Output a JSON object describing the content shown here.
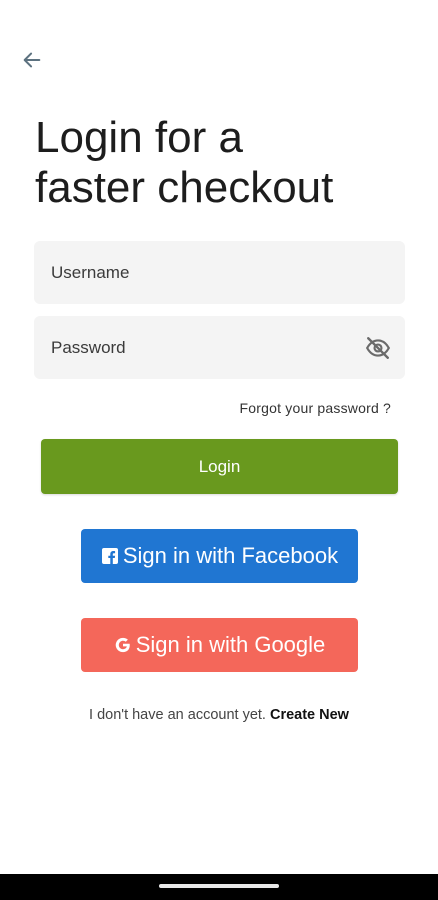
{
  "header": {
    "back_icon": "arrow-left-icon"
  },
  "title": "Login for a\nfaster checkout",
  "form": {
    "username_placeholder": "Username",
    "password_placeholder": "Password",
    "password_toggle_icon": "eye-off-icon",
    "forgot_password": "Forgot your password ?",
    "login_label": "Login"
  },
  "social": {
    "facebook_label": "Sign in with Facebook",
    "facebook_icon": "facebook-icon",
    "google_label": "Sign in with Google",
    "google_icon": "google-icon"
  },
  "signup": {
    "prompt": "I don't have an account yet.",
    "link": "Create New"
  },
  "colors": {
    "login_button": "#69991e",
    "facebook_button": "#2076d2",
    "google_button": "#f4675a",
    "field_background": "#f4f4f4"
  }
}
